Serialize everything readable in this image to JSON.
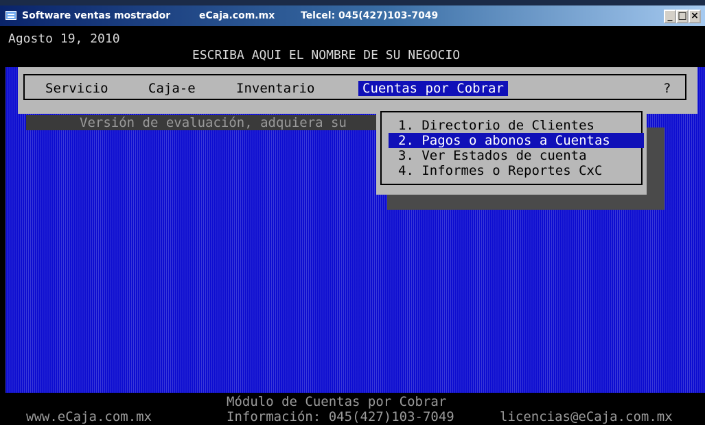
{
  "titlebar": {
    "app_name": "Software ventas mostrador",
    "site": "eCaja.com.mx",
    "phone": "Telcel: 045(427)103-7049",
    "minimize": "_",
    "maximize": "□",
    "close": "×"
  },
  "header": {
    "date": "Agosto 19, 2010",
    "business_name": "ESCRIBA AQUI EL NOMBRE DE SU NEGOCIO"
  },
  "menu": {
    "items": [
      {
        "label": "Servicio"
      },
      {
        "label": "Caja-e"
      },
      {
        "label": "Inventario"
      },
      {
        "label": "Cuentas por Cobrar",
        "active": true
      },
      {
        "label": "?"
      }
    ]
  },
  "eval_notice": "Versión de evaluación, adquiera su",
  "submenu": {
    "items": [
      {
        "label": "1. Directorio de Clientes"
      },
      {
        "label": "2. Pagos o abonos a Cuentas",
        "selected": true
      },
      {
        "label": "3. Ver Estados de cuenta"
      },
      {
        "label": "4. Informes o Reportes CxC"
      }
    ]
  },
  "footer": {
    "website": "www.eCaja.com.mx",
    "module": "Módulo de Cuentas por Cobrar",
    "info": "Información: 045(427)103-7049",
    "email": "licencias@eCaja.com.mx"
  },
  "colors": {
    "console_blue": "#0d0dd0",
    "highlight": "#1010b8",
    "menu_gray": "#b8b8b8"
  }
}
